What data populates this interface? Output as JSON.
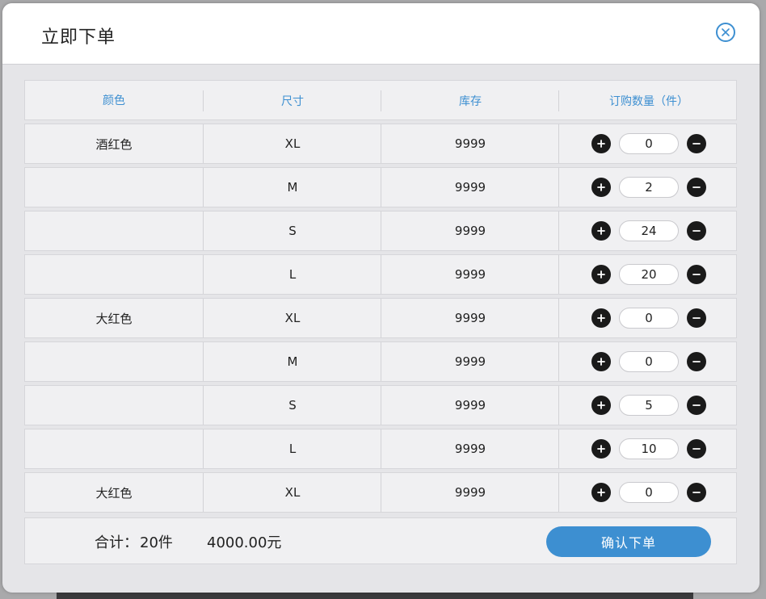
{
  "dialog": {
    "title": "立即下单"
  },
  "table": {
    "headers": {
      "color": "颜色",
      "size": "尺寸",
      "stock": "库存",
      "qty": "订购数量（件）"
    },
    "rows": [
      {
        "color": "酒红色",
        "size": "XL",
        "stock": "9999",
        "qty": "0"
      },
      {
        "color": "",
        "size": "M",
        "stock": "9999",
        "qty": "2"
      },
      {
        "color": "",
        "size": "S",
        "stock": "9999",
        "qty": "24"
      },
      {
        "color": "",
        "size": "L",
        "stock": "9999",
        "qty": "20"
      },
      {
        "color": "大红色",
        "size": "XL",
        "stock": "9999",
        "qty": "0"
      },
      {
        "color": "",
        "size": "M",
        "stock": "9999",
        "qty": "0"
      },
      {
        "color": "",
        "size": "S",
        "stock": "9999",
        "qty": "5"
      },
      {
        "color": "",
        "size": "L",
        "stock": "9999",
        "qty": "10"
      },
      {
        "color": "大红色",
        "size": "XL",
        "stock": "9999",
        "qty": "0"
      }
    ]
  },
  "footer": {
    "total_label": "合计：",
    "total_qty": "20件",
    "total_amount": "4000.00元",
    "confirm_label": "确认下单"
  },
  "colors": {
    "accent": "#3d8fd1",
    "button_dark": "#1a1a1a"
  },
  "icons": {
    "close": "close-circle-icon",
    "increment": "plus-circle-icon",
    "decrement": "minus-circle-icon"
  }
}
